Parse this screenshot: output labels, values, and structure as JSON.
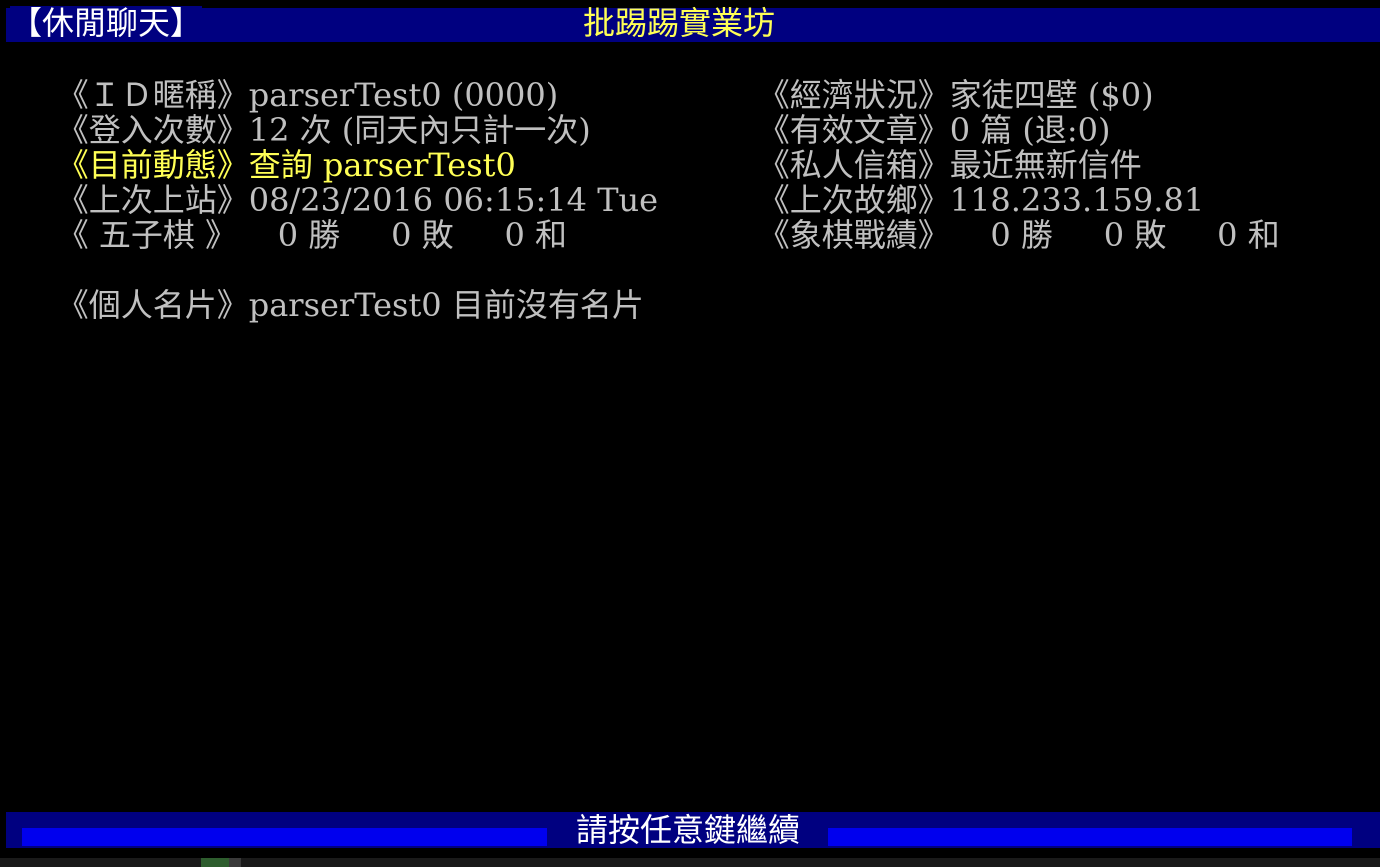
{
  "header": {
    "section_label": "【休閒聊天】",
    "board_title": "批踢踢實業坊"
  },
  "profile": {
    "id_label": "《ＩＤ暱稱》",
    "id_value": "parserTest0 (0000)",
    "money_label": "《經濟狀況》",
    "money_value": "家徒四壁 ($0)",
    "logins_label": "《登入次數》",
    "logins_value": "12 次 (同天內只計一次)",
    "posts_label": "《有效文章》",
    "posts_value": "0 篇 (退:0)",
    "activity_label": "《目前動態》",
    "activity_value": "查詢 parserTest0",
    "mailbox_label": "《私人信箱》",
    "mailbox_value": "最近無新信件",
    "last_login_label": "《上次上站》",
    "last_login_value": "08/23/2016 06:15:14 Tue",
    "last_ip_label": "《上次故鄉》",
    "last_ip_value": "118.233.159.81",
    "gomoku_label": "《 五子棋 》",
    "gomoku_record": "    0 勝     0 敗     0 和",
    "chess_label": "《象棋戰績》",
    "chess_record": "    0 勝     0 敗     0 和",
    "card_label": "《個人名片》",
    "card_value": "parserTest0 目前沒有名片"
  },
  "footer": {
    "prompt": "請按任意鍵繼續"
  }
}
